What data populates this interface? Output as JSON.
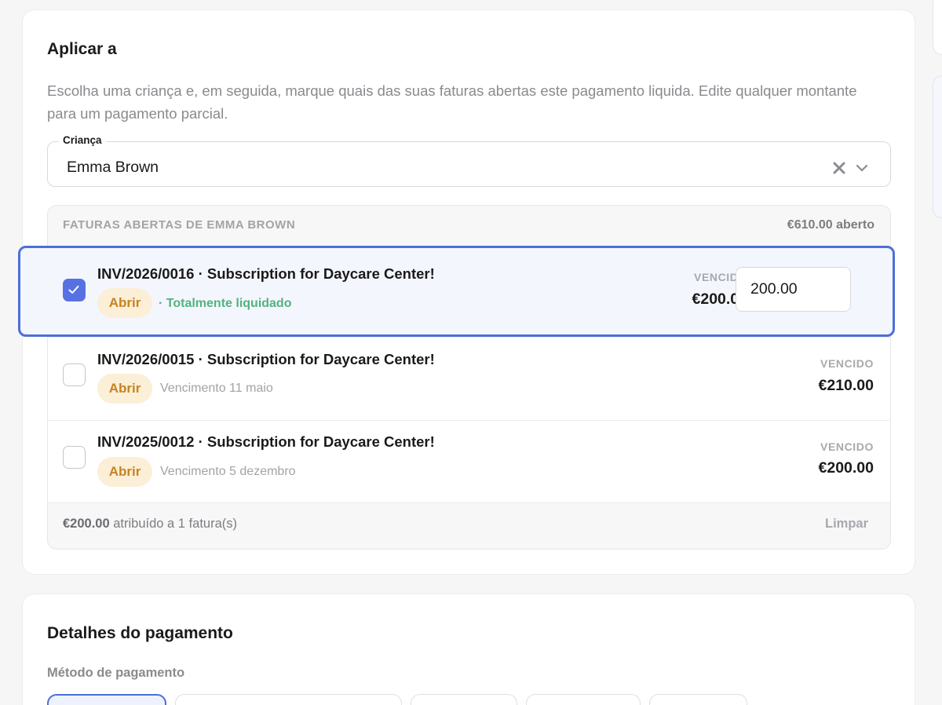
{
  "apply_section": {
    "title": "Aplicar a",
    "description": "Escolha uma criança e, em seguida, marque quais das suas faturas abertas este pagamento liquida. Edite qualquer montante para um pagamento parcial.",
    "child_select": {
      "label": "Criança",
      "value": "Emma Brown",
      "clear_icon": "close-icon",
      "dropdown_icon": "chevron-down-icon"
    },
    "open_invoices": {
      "header_label": "FATURAS ABERTAS DE EMMA BROWN",
      "total_amount": "€610.00",
      "total_suffix": "aberto",
      "items": [
        {
          "title": "INV/2026/0016 · Subscription for Daycare Center!",
          "status": "Abrir",
          "note": "· Totalmente liquidado",
          "due_label": "VENCIDO",
          "due_amount": "€200.00",
          "applied_amount": "200.00",
          "checked": true
        },
        {
          "title": "INV/2026/0015 · Subscription for Daycare Center!",
          "status": "Abrir",
          "note": "Vencimento 11 maio",
          "due_label": "VENCIDO",
          "due_amount": "€210.00",
          "checked": false
        },
        {
          "title": "INV/2025/0012 · Subscription for Daycare Center!",
          "status": "Abrir",
          "note": "Vencimento 5 dezembro",
          "due_label": "VENCIDO",
          "due_amount": "€200.00",
          "checked": false
        }
      ],
      "footer": {
        "assigned_amount": "€200.00",
        "assigned_text": "atribuído a 1 fatura(s)",
        "clear_label": "Limpar"
      }
    }
  },
  "payment_details": {
    "title": "Detalhes do pagamento",
    "method_label": "Método de pagamento"
  },
  "colors": {
    "accent": "#4d6fd8",
    "checkbox": "#5871e2",
    "badge_bg": "#fbefd8",
    "badge_text": "#c9821f",
    "settled_green": "#52b37e"
  }
}
